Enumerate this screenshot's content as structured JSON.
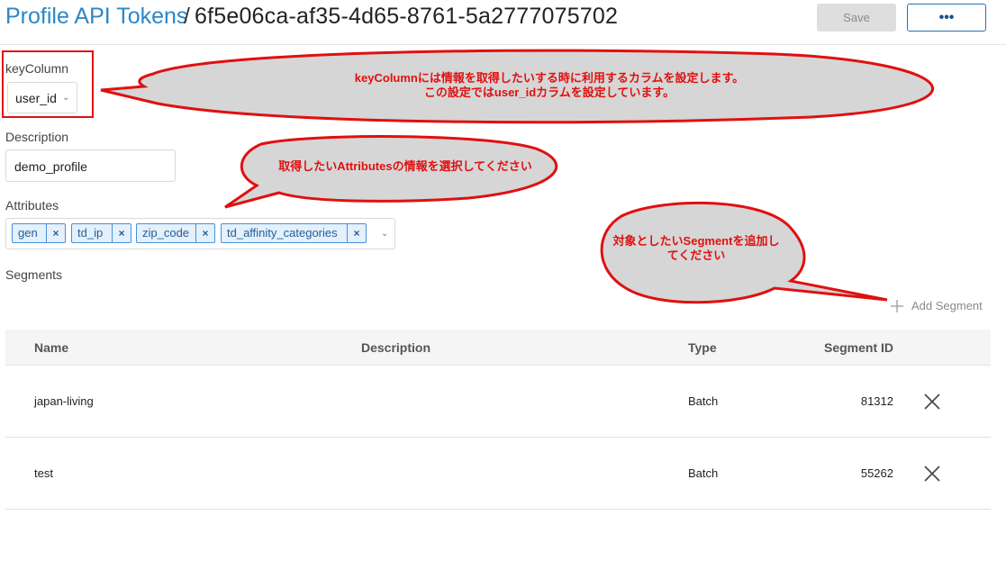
{
  "header": {
    "breadcrumb_link": "Profile API Tokens",
    "separator": "/",
    "token_id": "6f5e06ca-af35-4d65-8761-5a2777075702",
    "save_label": "Save",
    "more_label": "•••"
  },
  "form": {
    "key_column_label": "keyColumn",
    "key_column_value": "user_id",
    "description_label": "Description",
    "description_value": "demo_profile",
    "attributes_label": "Attributes",
    "attributes": [
      "gen",
      "td_ip",
      "zip_code",
      "td_affinity_categories"
    ],
    "tag_remove_glyph": "×",
    "segments_label": "Segments",
    "add_segment_label": "Add Segment"
  },
  "table": {
    "headers": [
      "Name",
      "Description",
      "Type",
      "Segment ID"
    ],
    "rows": [
      {
        "name": "japan-living",
        "description": "",
        "type": "Batch",
        "segment_id": "81312"
      },
      {
        "name": "test",
        "description": "",
        "type": "Batch",
        "segment_id": "55262"
      }
    ]
  },
  "annotations": {
    "key_column_note_1": "keyColumnには情報を取得したいする時に利用するカラムを設定します。",
    "key_column_note_2": "この設定ではuser_idカラムを設定しています。",
    "attributes_note": "取得したいAttributesの情報を選択してください",
    "segment_note_1": "対象としたいSegmentを追加し",
    "segment_note_2": "てください",
    "color": "#e01010",
    "bubble_fill": "#d6d6d6"
  }
}
